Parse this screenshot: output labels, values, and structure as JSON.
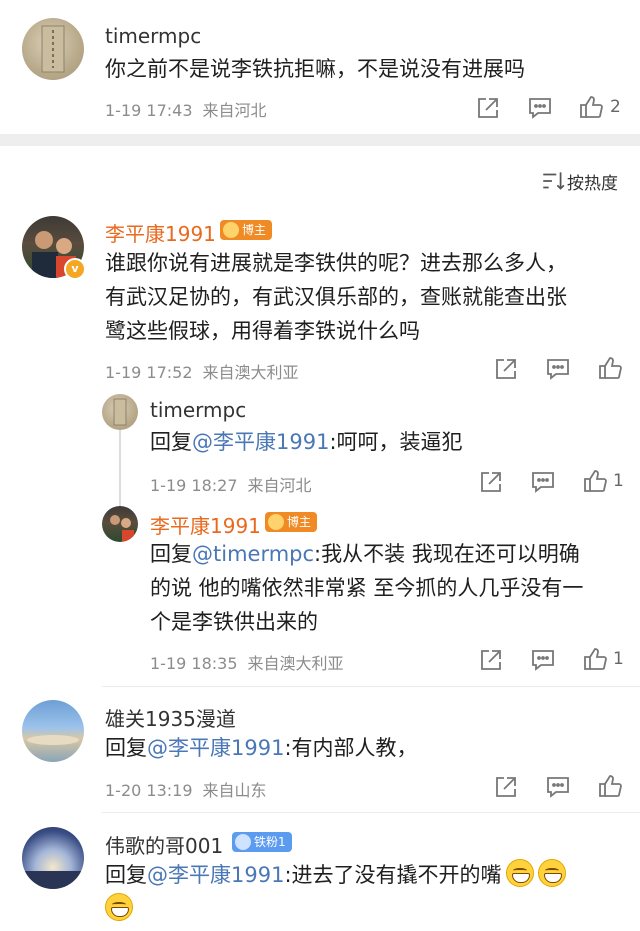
{
  "sort": {
    "label": "按热度"
  },
  "top_comment": {
    "username": "timermpc",
    "text": "你之前不是说李铁抗拒嘛，不是说没有进展吗",
    "time": "1-19 17:43",
    "location": "来自河北",
    "likes": "2"
  },
  "main_comment": {
    "username": "李平康1991",
    "badge": "博主",
    "text_lines": [
      "谁跟你说有进展就是李铁供的呢？进去那么多人，",
      "有武汉足协的，有武汉俱乐部的，查账就能查出张",
      "鹭这些假球，用得着李铁说什么吗"
    ],
    "time": "1-19 17:52",
    "location": "来自澳大利亚"
  },
  "reply_1": {
    "username": "timermpc",
    "prefix": "回复",
    "mention": "@李平康1991",
    "text": ":呵呵，装逼犯",
    "time": "1-19 18:27",
    "location": "来自河北",
    "likes": "1"
  },
  "reply_2": {
    "username": "李平康1991",
    "badge": "博主",
    "prefix": "回复",
    "mention": "@timermpc",
    "text_line1": ":我从不装 我现在还可以明确",
    "text_line2": "的说 他的嘴依然非常紧 至今抓的人几乎没有一",
    "text_line3": "个是李铁供出来的",
    "time": "1-19 18:35",
    "location": "来自澳大利亚",
    "likes": "1"
  },
  "comment_3": {
    "username": "雄关1935漫道",
    "prefix": "回复",
    "mention": "@李平康1991",
    "text": ":有内部人教，",
    "time": "1-20 13:19",
    "location": "来自山东"
  },
  "comment_4": {
    "username": "伟歌的哥001",
    "badge": "铁粉1",
    "prefix": "回复",
    "mention": "@李平康1991",
    "text": ":进去了没有撬不开的嘴"
  },
  "colors": {
    "mention": "#4a77b6",
    "blogger_name": "#e86a1f",
    "badge_blogger": "#f08a24",
    "badge_fan": "#5b9bf0"
  },
  "icons": [
    "share-icon",
    "comment-icon",
    "like-icon",
    "sort-icon",
    "grin-emoji"
  ]
}
